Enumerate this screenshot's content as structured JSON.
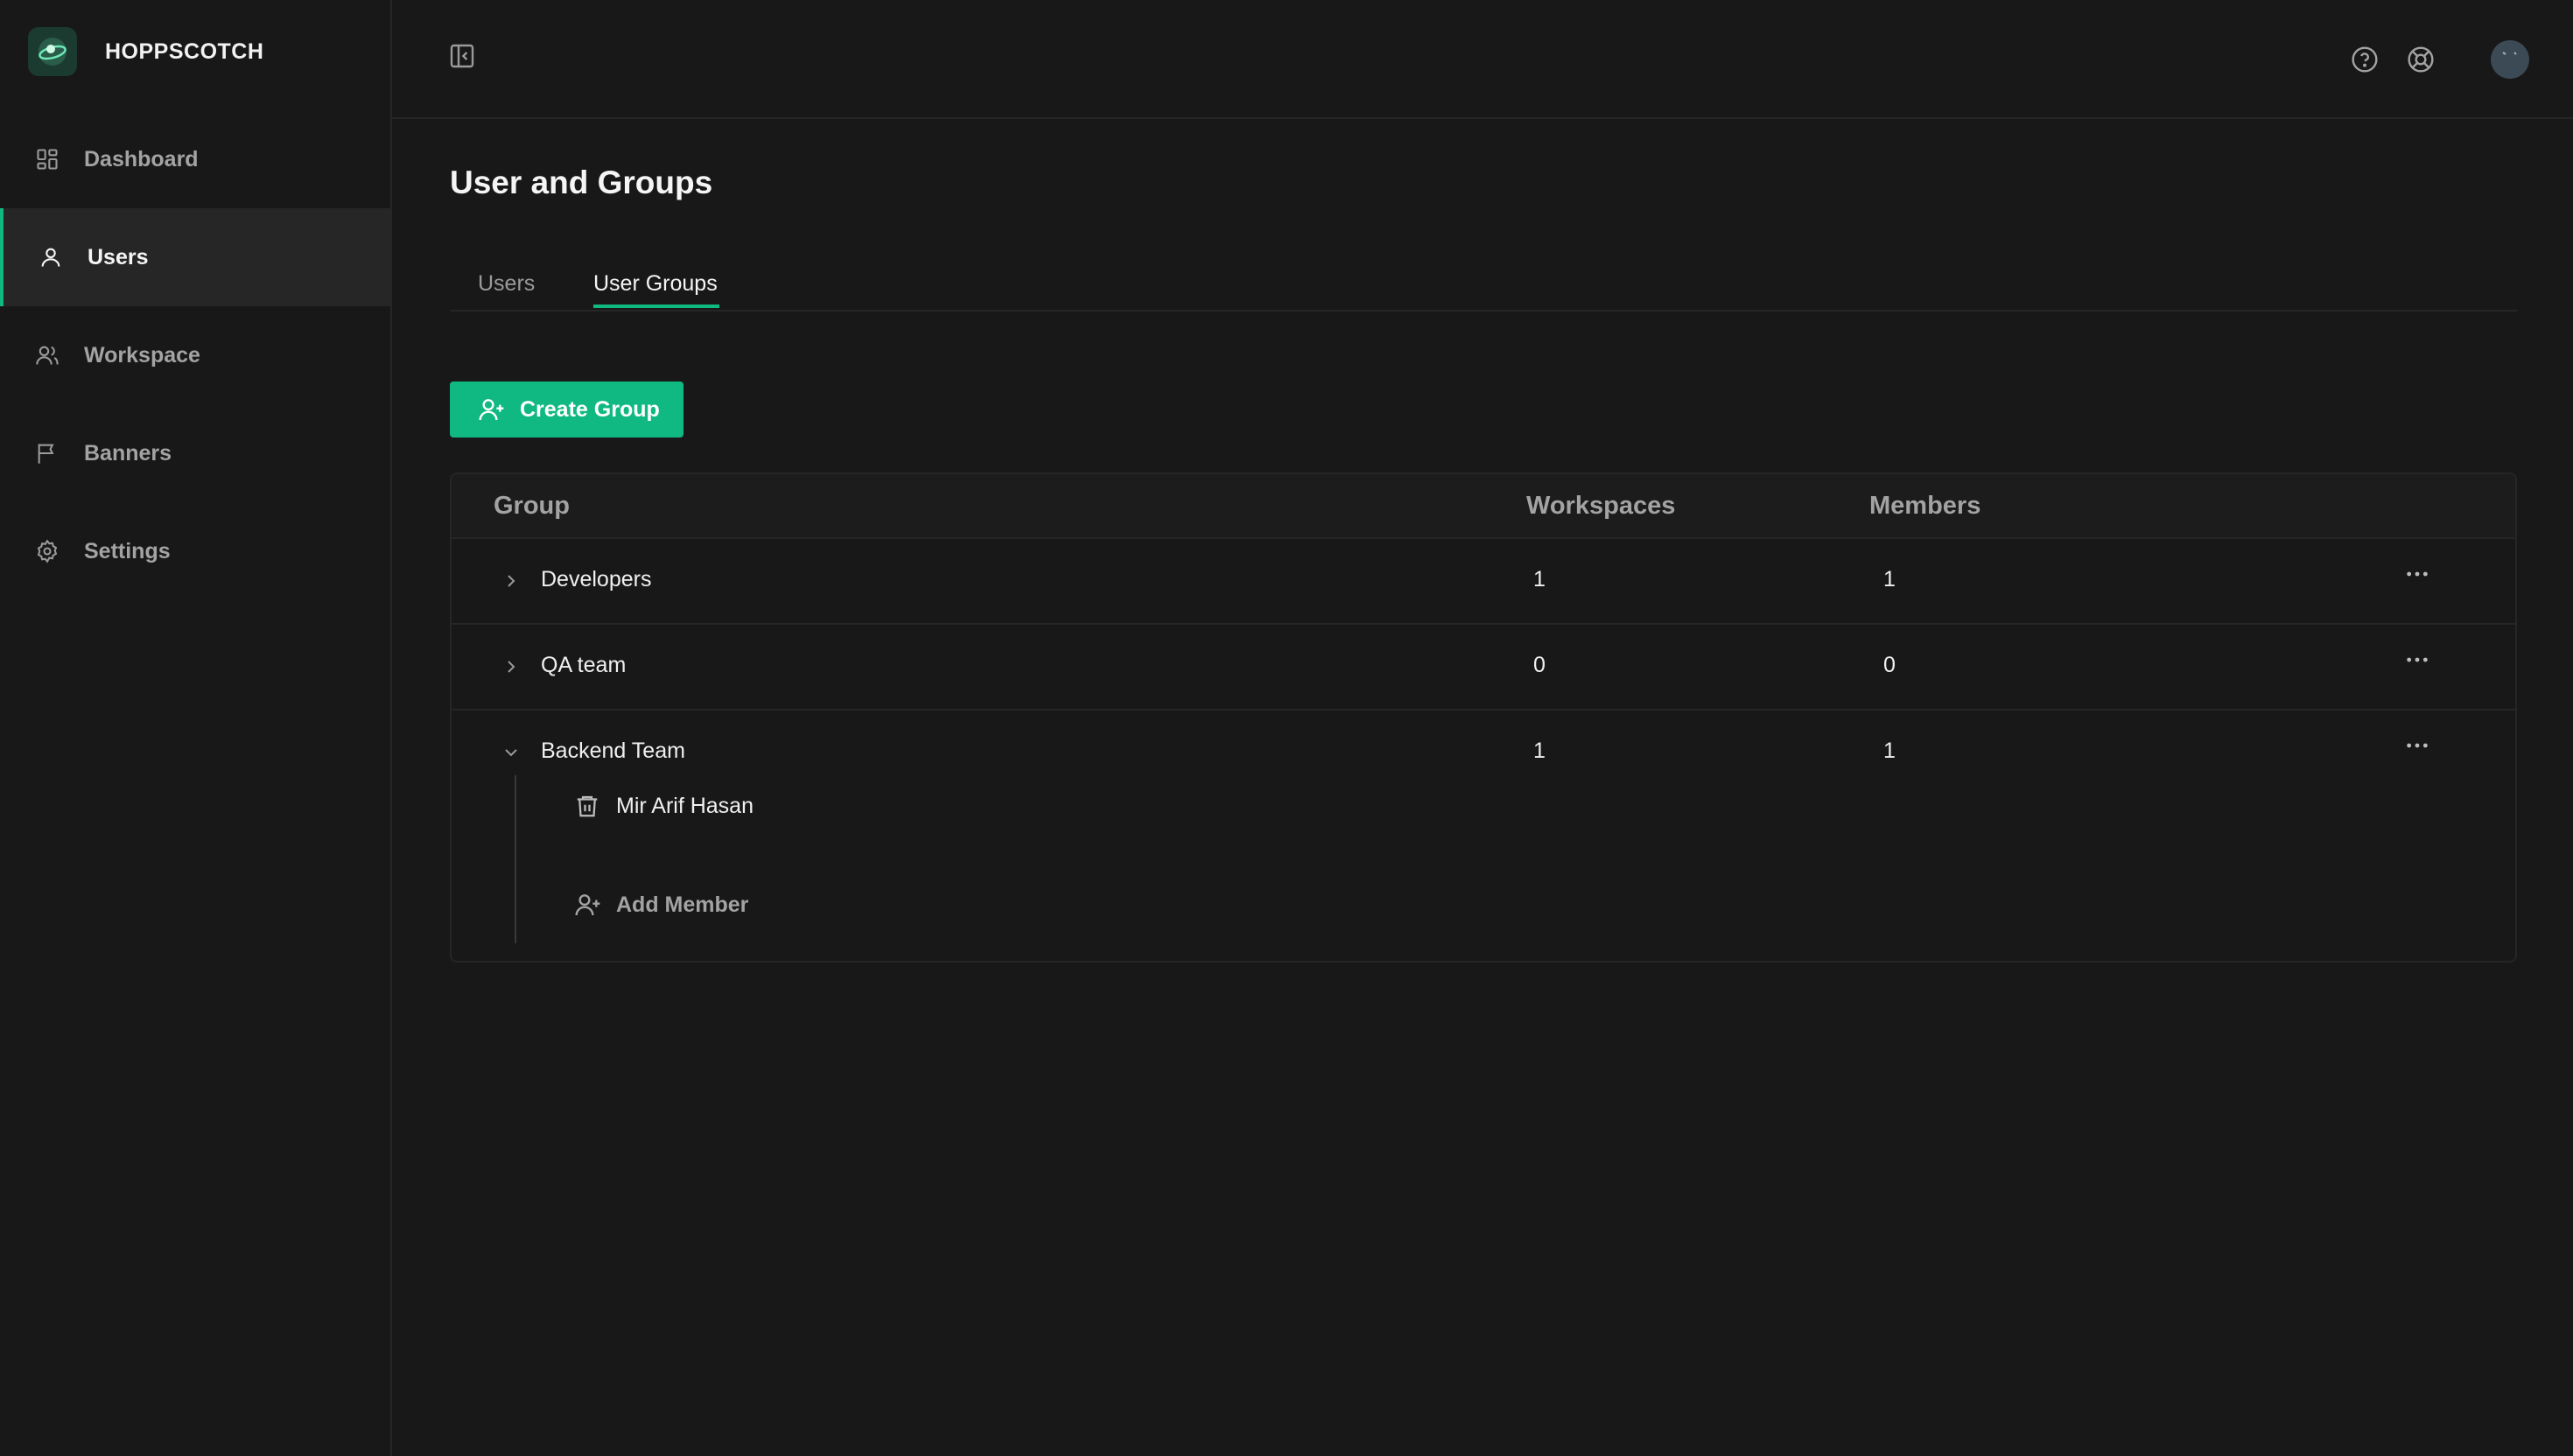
{
  "app": {
    "name": "HOPPSCOTCH"
  },
  "sidebar": {
    "items": [
      {
        "label": "Dashboard",
        "icon": "dashboard-icon",
        "active": false
      },
      {
        "label": "Users",
        "icon": "user-icon",
        "active": true
      },
      {
        "label": "Workspace",
        "icon": "users-icon",
        "active": false
      },
      {
        "label": "Banners",
        "icon": "flag-icon",
        "active": false
      },
      {
        "label": "Settings",
        "icon": "gear-icon",
        "active": false
      }
    ]
  },
  "header": {
    "icons": [
      "sidebar-collapse-icon",
      "help-icon",
      "support-icon",
      "avatar"
    ]
  },
  "page": {
    "title": "User and Groups",
    "tabs": [
      {
        "label": "Users",
        "active": false
      },
      {
        "label": "User Groups",
        "active": true
      }
    ],
    "create_button": "Create Group"
  },
  "table": {
    "columns": [
      "Group",
      "Workspaces",
      "Members"
    ],
    "rows": [
      {
        "name": "Developers",
        "workspaces": "1",
        "members": "1",
        "expanded": false
      },
      {
        "name": "QA team",
        "workspaces": "0",
        "members": "0",
        "expanded": false
      },
      {
        "name": "Backend Team",
        "workspaces": "1",
        "members": "1",
        "expanded": true,
        "member_list": [
          "Mir Arif Hasan"
        ],
        "add_member_label": "Add Member"
      }
    ]
  },
  "colors": {
    "accent": "#10b981",
    "background": "#181818",
    "panel": "#262626"
  }
}
